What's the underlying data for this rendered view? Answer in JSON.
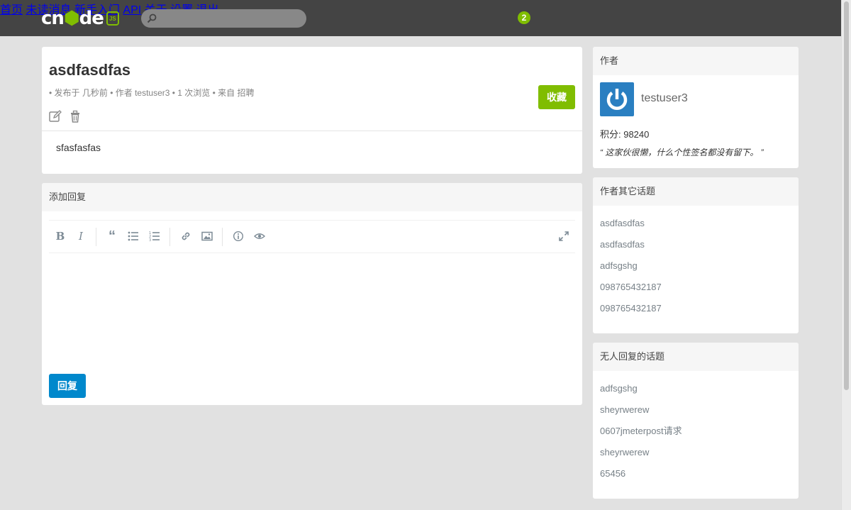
{
  "nav": {
    "search_placeholder": "",
    "links": [
      "首页",
      "未读消息",
      "新手入门",
      "API",
      "关于",
      "设置",
      "退出"
    ],
    "unread_count": "2"
  },
  "topic": {
    "title": "asdfasdfas",
    "meta": "• 发布于 几秒前 • 作者 testuser3 • 1 次浏览 • 来自 招聘",
    "collect_label": "收藏",
    "content": "sfasfasfas"
  },
  "reply": {
    "header": "添加回复",
    "submit_label": "回复"
  },
  "author": {
    "header": "作者",
    "name": "testuser3",
    "score": "积分: 98240",
    "signature": "“ 这家伙很懒，什么个性签名都没有留下。 ”"
  },
  "other_topics": {
    "header": "作者其它话题",
    "items": [
      "asdfasdfas",
      "asdfasdfas",
      "adfsgshg",
      "098765432187",
      "098765432187"
    ]
  },
  "no_reply_topics": {
    "header": "无人回复的话题",
    "items": [
      "adfsgshg",
      "sheyrwerew",
      "0607jmeterpost请求",
      "sheyrwerew",
      "65456"
    ]
  },
  "colors": {
    "navbar": "#444444",
    "accent_green": "#80bd01",
    "reply_blue": "#0088cc"
  }
}
